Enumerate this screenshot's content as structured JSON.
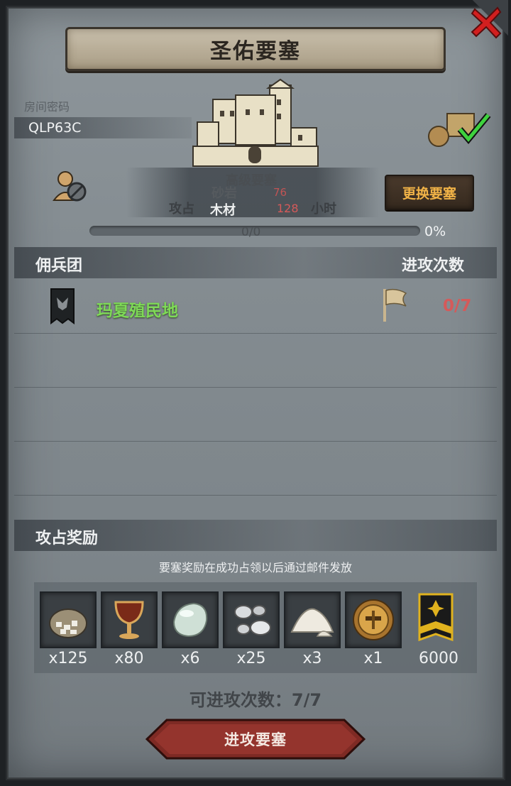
{
  "title": "圣佑要塞",
  "room": {
    "label": "房间密码",
    "code": "QLP63C"
  },
  "info": {
    "level_label": "高级要塞",
    "stone_label": "砂岩",
    "stone_value": "76",
    "occupy_label": "攻占",
    "wood_label": "木材",
    "wood_value": "128",
    "per_hour": "小时"
  },
  "change_button": "更换要塞",
  "progress": {
    "count": "0/0",
    "percent": "0%",
    "fraction": 0
  },
  "mercenary": {
    "header": "佣兵团",
    "attacks_header": "进攻次数",
    "rows": [
      {
        "name": "玛夏殖民地",
        "attacks": "0/7"
      }
    ]
  },
  "reward": {
    "header": "攻占奖励",
    "note": "要塞奖励在成功占领以后通过邮件发放",
    "items": [
      {
        "icon": "sack-of-stones-icon",
        "count": "x125"
      },
      {
        "icon": "goblet-icon",
        "count": "x80"
      },
      {
        "icon": "gem-stone-icon",
        "count": "x6"
      },
      {
        "icon": "silver-ore-icon",
        "count": "x25"
      },
      {
        "icon": "salt-pile-icon",
        "count": "x3"
      },
      {
        "icon": "golden-helmet-icon",
        "count": "x1"
      },
      {
        "icon": "honor-banner-icon",
        "count": "6000"
      }
    ]
  },
  "attack_times": "可进攻次数：7/7",
  "attack_button": "进攻要塞",
  "colors": {
    "accent_orange": "#f1b347",
    "green_name": "#7ed957",
    "red_count": "#d45a5a",
    "close_red": "#d21f1f"
  }
}
